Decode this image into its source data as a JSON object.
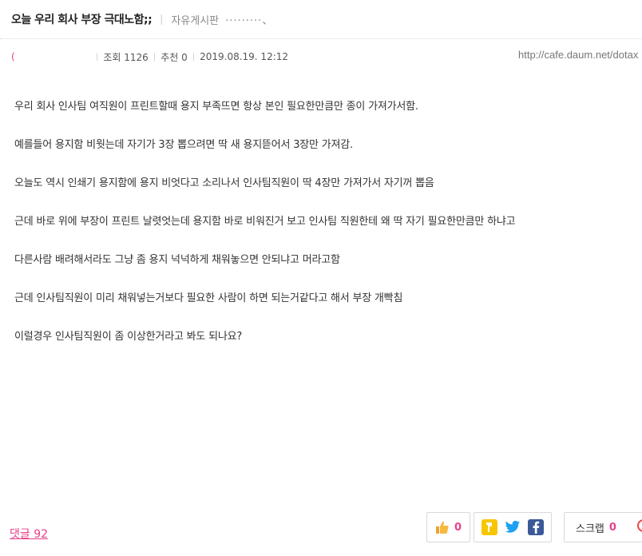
{
  "header": {
    "title": "오늘 우리 회사 부장 극대노함;;",
    "board": "자유게시판",
    "board_extra": "·········、"
  },
  "meta": {
    "nickname": "(",
    "views": "조회 1126",
    "recommend": "추천 0",
    "date": "2019.08.19. 12:12",
    "url": "http://cafe.daum.net/dotax"
  },
  "content": {
    "paragraphs": [
      "우리 회사 인사팀 여직원이 프린트할때 용지 부족뜨면 항상 본인 필요한만큼만 종이 가져가서함.",
      "예를들어 용지함 비웟는데 자기가 3장 뽑으려면 딱 새 용지뜯어서 3장만 가져감.",
      "오늘도 역시 인쇄기 용지함에 용지 비엇다고 소리나서 인사팀직원이 딱 4장만 가져가서 자기꺼 뽑음",
      "근데 바로 위에 부장이 프린트 날렷엇는데 용지함 바로 비워진거 보고 인사팀 직원한테 왜 딱 자기 필요한만큼만 하냐고",
      "다른사람 배려해서라도 그냥 좀 용지 넉넉하게 채워놓으면 안되냐고 머라고함",
      "근데 인사팀직원이 미리 채워넣는거보다 필요한 사람이 하면 되는거같다고 해서 부장 개빡침",
      "이럴경우 인사팀직원이 좀 이상한거라고 봐도 되나요?"
    ]
  },
  "footer": {
    "comments": "댓글 92",
    "like_count": "0",
    "scrap_label": "스크랩",
    "scrap_count": "0"
  },
  "icons": {
    "like": "thumbs-up-icon",
    "kakao": "kakao-story-icon",
    "twitter": "twitter-icon",
    "facebook": "facebook-icon"
  },
  "colors": {
    "accent": "#e7418b",
    "kakao": "#f7c600",
    "twitter": "#1da1f2",
    "facebook": "#3b5998"
  }
}
